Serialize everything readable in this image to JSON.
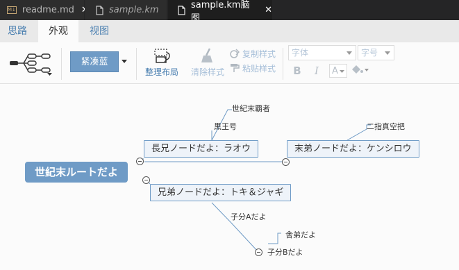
{
  "tabs": [
    {
      "label": "readme.md",
      "icon": "markdown-file-icon",
      "close": "✕"
    },
    {
      "label": "sample.km",
      "icon": "file-icon"
    },
    {
      "label": "sample.km脑图",
      "icon": "file-icon",
      "close": "✕"
    }
  ],
  "menu": {
    "thought": "思路",
    "appearance": "外观",
    "view": "视图"
  },
  "toolbar": {
    "theme_label": "紧凑蓝",
    "layout_label": "整理布局",
    "clear_style_label": "清除样式",
    "copy_style_label": "复制样式",
    "paste_style_label": "粘贴样式",
    "font_placeholder": "字体",
    "size_placeholder": "字号",
    "bold_label": "B",
    "italic_label": "I",
    "font_color_label": "A"
  },
  "colors": {
    "accent": "#6f9bc6",
    "tabbar": "#252526",
    "active_tab": "#1e1e1e",
    "menubar": "#e9e9e9"
  },
  "mindmap": {
    "root": "世紀末ルートだよ",
    "node_raoh": "長兄ノードだよ：ラオウ",
    "node_raoh_child1": "世紀末覇者",
    "node_raoh_child2": "黒王号",
    "node_kenshiro": "末弟ノードだよ：ケンシロウ",
    "node_kenshiro_child": "二指真空把",
    "node_toki": "兄弟ノードだよ：トキ＆ジャギ",
    "node_toki_child1": "子分Aだよ",
    "node_toki_child2": "子分Bだよ",
    "node_toki_grandchild": "舎弟だよ"
  }
}
